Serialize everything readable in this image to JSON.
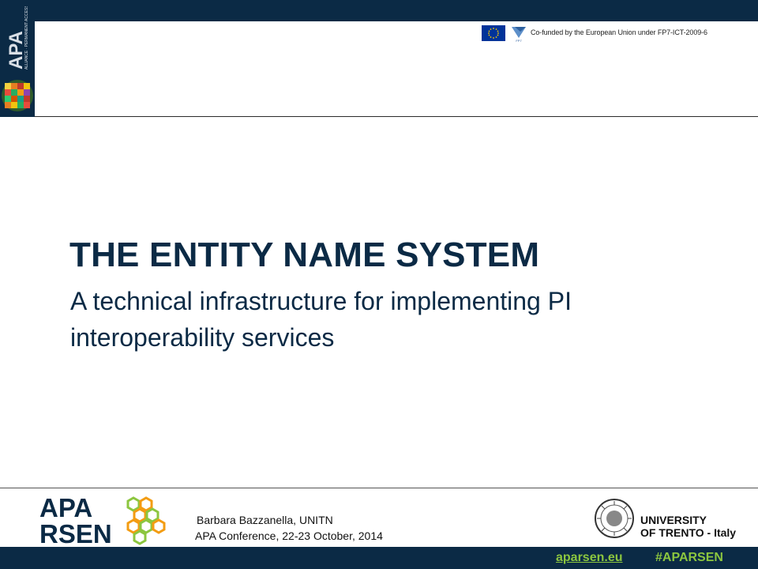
{
  "header": {
    "cofunded_text": "Co-funded by the European Union under FP7-ICT-2009-6",
    "side_logo_text": "APA",
    "side_logo_subtext": "ALLIANCE FOR PERMANENT ACCESS"
  },
  "slide": {
    "title": "THE ENTITY NAME SYSTEM",
    "subtitle": "A technical infrastructure for implementing PI interoperability services"
  },
  "footer": {
    "logo_line1": "APA",
    "logo_line2": "RSEN",
    "author": "Barbara Bazzanella, UNITN",
    "conference": "APA Conference, 22-23 October, 2014",
    "university_line1": "UNIVERSITY",
    "university_line2": "OF TRENTO - Italy",
    "site_link": "aparsen.eu",
    "hashtag": "#APARSEN"
  },
  "colors": {
    "navy": "#0b2a45",
    "green": "#8cc63f",
    "orange": "#f39c12"
  },
  "icons": [
    "apa-side-logo",
    "eu-flag-icon",
    "fp7-logo-icon",
    "aparsen-logo",
    "university-seal-icon"
  ]
}
